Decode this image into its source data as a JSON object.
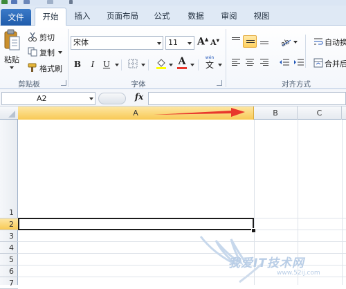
{
  "ribbon": {
    "tabs": [
      "文件",
      "开始",
      "插入",
      "页面布局",
      "公式",
      "数据",
      "审阅",
      "视图"
    ],
    "active_tab": "开始",
    "clipboard": {
      "paste": "粘贴",
      "cut": "剪切",
      "copy": "复制",
      "format_painter": "格式刷",
      "group_label": "剪贴板"
    },
    "font": {
      "font_name": "宋体",
      "font_size": "11",
      "grow": "A",
      "shrink": "A",
      "bold": "B",
      "italic": "I",
      "underline": "U",
      "font_color": "A",
      "phonetic_top": "wén",
      "phonetic_char": "文",
      "group_label": "字体"
    },
    "alignment": {
      "wrap_text": "自动换",
      "merge_center": "合并后",
      "group_label": "对齐方式"
    }
  },
  "formula_bar": {
    "name_box": "A2",
    "fx": "fx",
    "formula": ""
  },
  "grid": {
    "columns": [
      "A",
      "B",
      "C"
    ],
    "rows": [
      "1",
      "2",
      "3",
      "4",
      "5",
      "6",
      "7"
    ],
    "selected_column": "A",
    "selected_row": "2",
    "active_cell": "A2"
  },
  "colors": {
    "accent": "#1f5cab",
    "selection": "#f8c955",
    "arrow": "#e8372c"
  },
  "watermark": {
    "text": "我爱IT技术网",
    "url": "www.52ij.com"
  }
}
